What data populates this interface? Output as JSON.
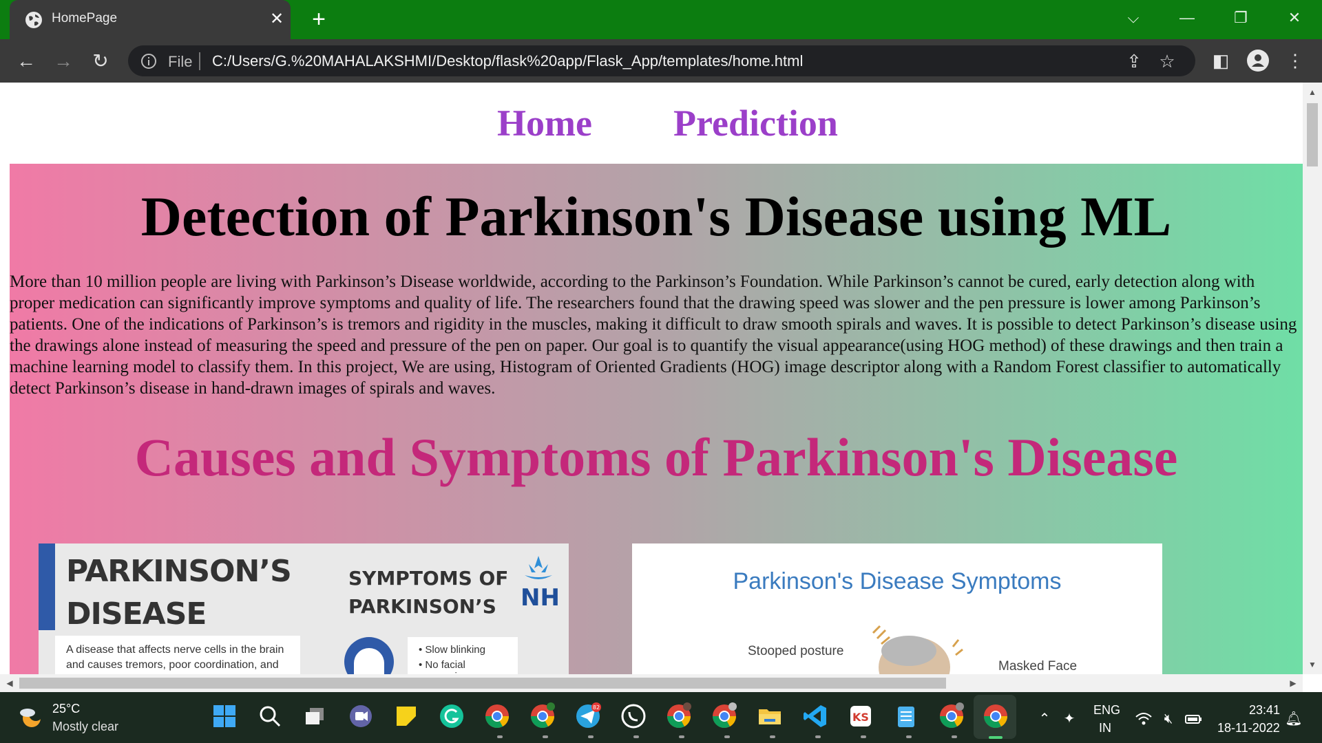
{
  "browser": {
    "tab_title": "HomePage",
    "tab_close": "✕",
    "new_tab": "+",
    "omnibox_scheme": "File",
    "url": "C:/Users/G.%20MAHALAKSHMI/Desktop/flask%20app/Flask_App/templates/home.html"
  },
  "site": {
    "nav": [
      "Home",
      "Prediction"
    ],
    "title": "Detection of Parkinson's Disease using ML",
    "intro": "More than 10 million people are living with Parkinson’s Disease worldwide, according to the Parkinson’s Foundation. While Parkinson’s cannot be cured, early detection along with proper medication can significantly improve symptoms and quality of life. The researchers found that the drawing speed was slower and the pen pressure is lower among Parkinson’s patients. One of the indications of Parkinson’s is tremors and rigidity in the muscles, making it difficult to draw smooth spirals and waves. It is possible to detect Parkinson’s disease using the drawings alone instead of measuring the speed and pressure of the pen on paper. Our goal is to quantify the visual appearance(using HOG method) of these drawings and then train a machine learning model to classify them. In this project, We are using, Histogram of Oriented Gradients (HOG) image descriptor along with a Random Forest classifier to automatically detect Parkinson’s disease in hand-drawn images of spirals and waves.",
    "section_title": "Causes and Symptoms of Parkinson's Disease"
  },
  "card1": {
    "heading_line1": "PARKINSON’S",
    "heading_line2": "DISEASE",
    "description": "A disease that affects nerve cells in the brain and causes tremors, poor coordination, and problems",
    "symptoms_line1": "SYMPTOMS OF",
    "symptoms_line2": "PARKINSON’S",
    "bullets": [
      "Slow blinking",
      "No facial expression"
    ]
  },
  "card2": {
    "title": "Parkinson's Disease Symptoms",
    "label1": "Stooped posture",
    "label2": "Masked Face"
  },
  "taskbar": {
    "temperature": "25°C",
    "weather": "Mostly clear",
    "lang1": "ENG",
    "lang2": "IN",
    "time": "23:41",
    "date": "18-11-2022",
    "telegram_badge": "82"
  },
  "colors": {
    "tabbar": "#0c7d10",
    "nav_link": "#9b3fc9",
    "section_title": "#c4287a",
    "gradient_left": "#f07aa6",
    "gradient_right": "#6fdea6"
  }
}
